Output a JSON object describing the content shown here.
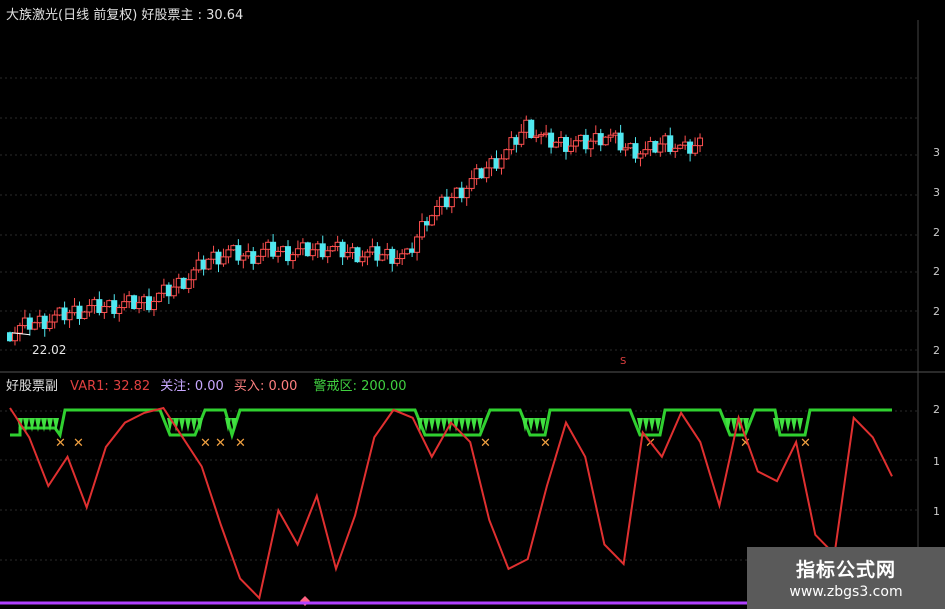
{
  "main_panel": {
    "title": "大族激光(日线 前复权)",
    "indicator": "好股票主",
    "value": "30.64",
    "low_marker": "22.02",
    "right_ticks": [
      "3",
      "3",
      "2",
      "2",
      "2",
      "2"
    ],
    "s_marker": "S"
  },
  "sub_panel": {
    "title": "好股票副",
    "items": [
      {
        "label": "VAR1",
        "value": "32.82",
        "color": "#e04040"
      },
      {
        "label": "关注",
        "value": "0.00",
        "color": "#c8a8ff"
      },
      {
        "label": "买入",
        "value": "0.00",
        "color": "#ff8080"
      },
      {
        "label": "警戒区",
        "value": "200.00",
        "color": "#40d040"
      }
    ],
    "right_ticks": [
      "2",
      "1",
      "1"
    ]
  },
  "watermark": {
    "title": "指标公式网",
    "url": "www.zbgs3.com"
  },
  "chart_data": [
    {
      "type": "candlestick",
      "title": "大族激光(日线 前复权)",
      "approx_close_path": [
        22.0,
        22.4,
        22.6,
        22.9,
        23.1,
        23.2,
        23.3,
        23.4,
        23.9,
        24.5,
        25.3,
        25.6,
        25.4,
        25.7,
        25.6,
        25.7,
        25.8,
        25.6,
        25.5,
        25.5,
        25.4,
        27.2,
        27.9,
        28.6,
        29.4,
        30.1,
        31.3,
        30.6,
        30.5,
        30.5,
        30.9,
        30.3,
        30.1,
        30.6,
        30.2,
        30.6
      ],
      "last_value": 30.64,
      "low_label": 22.02
    },
    {
      "type": "line",
      "title": "好股票副",
      "series": [
        {
          "name": "VAR1",
          "last_value": 32.82,
          "values": [
            200,
            170,
            120,
            150,
            98,
            160,
            185,
            195,
            200,
            170,
            140,
            80,
            25,
            5,
            95,
            60,
            110,
            35,
            90,
            170,
            198,
            190,
            150,
            185,
            165,
            85,
            35,
            45,
            120,
            185,
            150,
            60,
            40,
            175,
            150,
            195,
            165,
            100,
            190,
            135,
            125,
            165,
            70,
            50,
            190,
            170,
            130
          ]
        },
        {
          "name": "警戒区",
          "constant": 200.0
        },
        {
          "name": "关注",
          "constant": 0.0
        },
        {
          "name": "买入",
          "constant": 0.0
        }
      ]
    }
  ]
}
